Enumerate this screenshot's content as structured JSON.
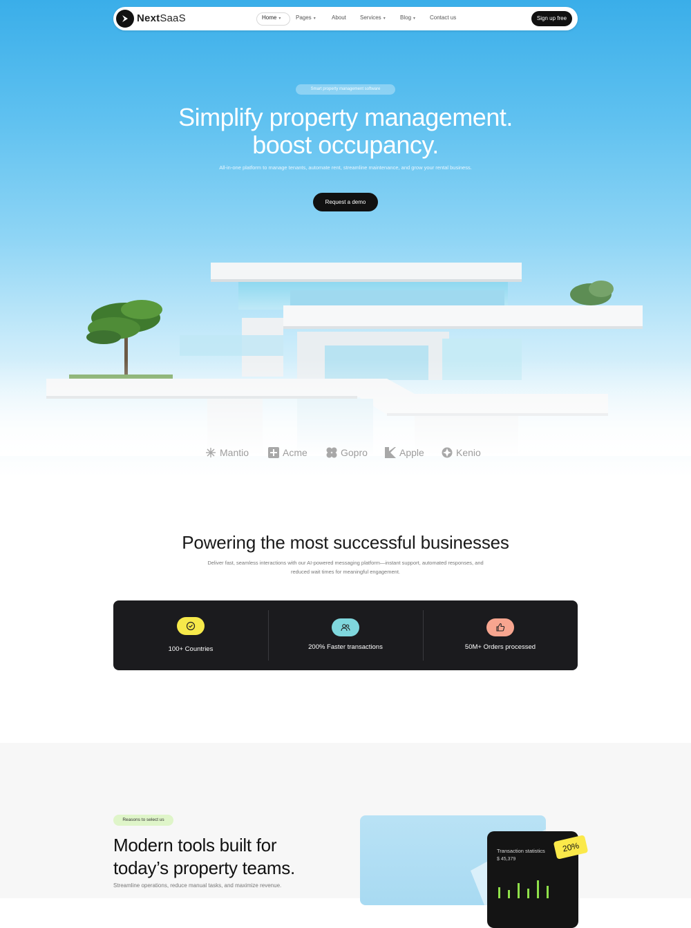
{
  "nav": {
    "logo_bold": "Next",
    "logo_light": "SaaS",
    "items": [
      {
        "label": "Home",
        "has_dropdown": true
      },
      {
        "label": "Pages",
        "has_dropdown": true
      },
      {
        "label": "About",
        "has_dropdown": false
      },
      {
        "label": "Services",
        "has_dropdown": true
      },
      {
        "label": "Blog",
        "has_dropdown": true
      },
      {
        "label": "Contact us",
        "has_dropdown": false
      }
    ],
    "cta": "Sign up free"
  },
  "hero": {
    "eyebrow": "Smart property management software",
    "title_line1": "Simplify property management.",
    "title_line2": "boost occupancy.",
    "subtitle": "All-in-one platform to manage tenants, automate rent, streamline maintenance, and grow your rental business.",
    "cta": "Request a demo"
  },
  "brands": [
    {
      "name": "Mantio",
      "icon": "sunburst-icon"
    },
    {
      "name": "Acme",
      "icon": "plus-square-icon"
    },
    {
      "name": "Gopro",
      "icon": "clover-icon"
    },
    {
      "name": "Apple",
      "icon": "k-shape-icon"
    },
    {
      "name": "Kenio",
      "icon": "star-circle-icon"
    }
  ],
  "powering": {
    "title": "Powering the most successful businesses",
    "subtitle_line1": "Deliver fast, seamless interactions with our AI-powered messaging platform—instant support, automated responses, and",
    "subtitle_line2": "reduced wait times for meaningful engagement."
  },
  "stats": [
    {
      "label": "100+ Countries",
      "icon": "check-badge-icon",
      "color": "#f6e94a"
    },
    {
      "label": "200% Faster transactions",
      "icon": "users-icon",
      "color": "#7fd7dd"
    },
    {
      "label": "50M+ Orders processed",
      "icon": "thumbs-up-icon",
      "color": "#f7a58f"
    }
  ],
  "reasons": {
    "tag": "Reasons to select us",
    "title_line1": "Modern tools built for",
    "title_line2": "today’s property teams.",
    "subtitle": "Streamline operations, reduce manual tasks, and maximize revenue.",
    "card_title": "Transaction statistics",
    "card_value": "$ 45,379",
    "badge": "20%"
  },
  "colors": {
    "accent_dark": "#111111",
    "sky_blue": "#3aaee9",
    "stats_bg": "#1b1b1e",
    "tag_green": "#dff5c9",
    "badge_yellow": "#fbe94a"
  }
}
